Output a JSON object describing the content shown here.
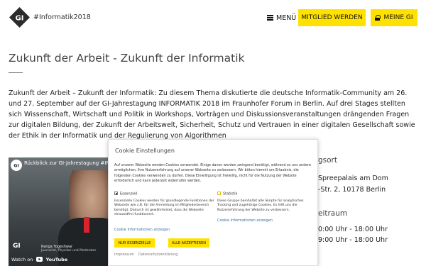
{
  "header": {
    "tagline": "#Informatik2018",
    "menu_label": "MENÜ",
    "join_label": "MITGLIED WERDEN",
    "mygi_label": "MEINE GI"
  },
  "main": {
    "title": "Zukunft der Arbeit - Zukunft der Informatik",
    "intro": "Zukunft der Arbeit – Zukunft der Informatik: Zu diesem Thema diskutierte die deutsche Informatik-Community am 26. und 27. September auf der GI-Jahrestagung INFORMATIK 2018 im Fraunhofer Forum in Berlin. Auf drei Stages stellten sich Wissenschaft, Wirtschaft und Politik in Workshops, Vorträgen und Diskussionsveranstaltungen drängenden Fragen zur digitalen Bildung, der Zukunft der Arbeitswelt, Sicherheit, Schutz und Vertrauen in einer digitalen Gesellschaft sowie der Ethik in der Informatik und der Regulierung von Algorithmen"
  },
  "video": {
    "title": "Rückblick zur GI-Jahrestagung #IN",
    "watch_label": "Watch on",
    "youtube_label": "YouTube",
    "brand": "GI",
    "speaker_name": "Ranga Yogeshwar",
    "speaker_role": "Journalist, Physiker und Moderator"
  },
  "sidebar": {
    "venue_heading": "gsort",
    "venue_line1": "Spreepalais am Dom",
    "venue_line2": "-Str. 2, 10178 Berlin",
    "time_heading": "eitraum",
    "time_line1": "0:00 Uhr - 18:00 Uhr",
    "time_line2": "9:00 Uhr - 18:00 Uhr"
  },
  "cookie": {
    "title": "Cookie Einstellungen",
    "description": "Auf unserer Webseite werden Cookies verwendet. Einige davon werden zwingend benötigt, während es uns andere ermöglichen, Ihre Nutzererfahrung auf unserer Webseite zu verbessern. Wir bitten hiermit um Erlaubnis, die folgenden Cookies verwenden zu dürfen. Diese Einwilligung ist freiwillig, nicht für die Nutzung der Website erforderlich und kann jederzeit widerrufen werden.",
    "essential_label": "Essenziell",
    "essential_desc": "Essenzielle Cookies werden für grundlegende Funktionen der Webseite wie z.B. für die Anmeldung im Mitgliederbereich benötigt. Dadurch ist gewährleistet, dass die Webseite einwandfrei funktioniert.",
    "stats_label": "Statistik",
    "stats_desc": "Diese Gruppe beinhaltet alle Skripte für analytisches Tracking und zugehörige Cookies. Es hilft uns die Nutzererfahrung der Website zu verbessern.",
    "info_link_1": "Cookie Informationen anzeigen",
    "info_link_2": "Cookie Informationen anzeigen",
    "only_essential_btn": "NUR ESSENZIELLE",
    "accept_all_btn": "ALLE AKZEPTIEREN",
    "imprint_link": "Impressum",
    "privacy_link": "Datenschutzerklärung"
  },
  "colors": {
    "accent_yellow": "#ffe100",
    "link_blue": "#3a6ea5"
  }
}
